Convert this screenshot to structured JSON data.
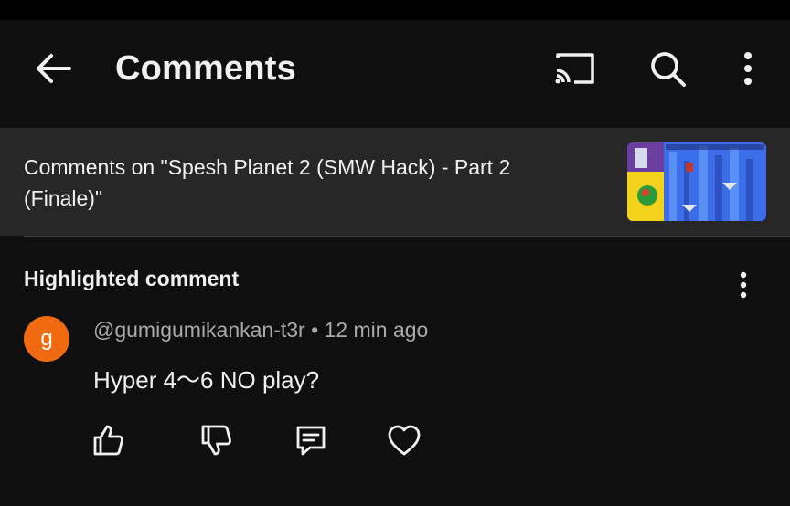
{
  "appbar": {
    "title": "Comments",
    "back_icon": "arrow-left-icon",
    "cast_icon": "cast-icon",
    "search_icon": "search-icon",
    "more_icon": "more-vertical-icon"
  },
  "video": {
    "caption": "Comments on \"Spesh Planet 2 (SMW Hack) - Part 2 (Finale)\""
  },
  "highlighted": {
    "label": "Highlighted comment",
    "more_icon": "more-vertical-icon"
  },
  "comment": {
    "avatar_letter": "g",
    "avatar_color": "#f06a11",
    "meta": "@gumigumikankan-t3r • 12 min ago",
    "text": "Hyper 4〜6 NO play?"
  },
  "actions": {
    "like_icon": "thumbs-up-icon",
    "dislike_icon": "thumbs-down-icon",
    "reply_icon": "reply-comment-icon",
    "heart_icon": "heart-icon"
  },
  "colors": {
    "background": "#0f0f0f",
    "banner": "#272727",
    "text_primary": "#f1f1f1",
    "text_secondary": "#aaaaaa"
  }
}
